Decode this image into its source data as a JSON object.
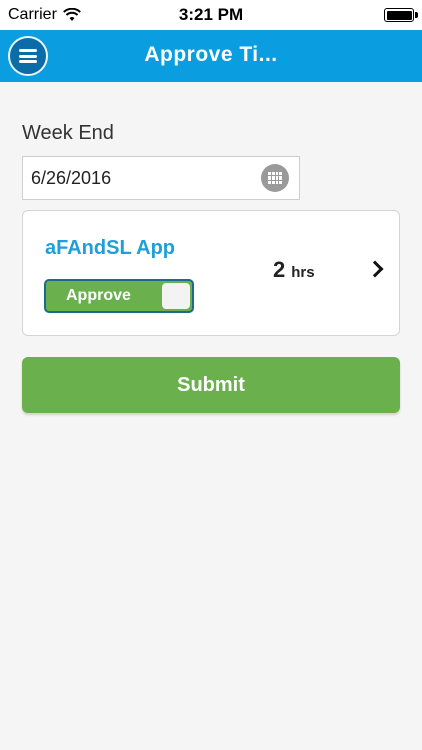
{
  "status_bar": {
    "carrier": "Carrier",
    "time": "3:21 PM",
    "wifi_icon": "wifi-icon",
    "battery_icon": "battery-icon"
  },
  "nav": {
    "title": "Approve Ti...",
    "menu_icon": "hamburger-menu-icon",
    "color": "#0a9ee0"
  },
  "form": {
    "week_end_label": "Week End",
    "week_end_value": "6/26/2016",
    "calendar_icon": "calendar-icon"
  },
  "card": {
    "app_name": "aFAndSL App",
    "toggle_label": "Approve",
    "toggle_state": "on",
    "hours_value": "2",
    "hours_unit": "hrs",
    "chevron_icon": "chevron-right-icon"
  },
  "submit": {
    "label": "Submit",
    "color": "#6ab04c"
  }
}
